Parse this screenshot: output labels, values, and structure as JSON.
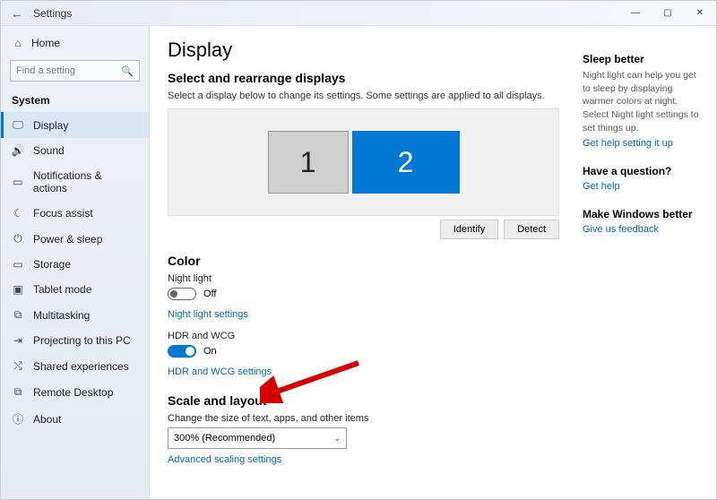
{
  "window": {
    "title": "Settings"
  },
  "sidebar": {
    "home": "Home",
    "search_placeholder": "Find a setting",
    "section": "System",
    "items": [
      {
        "label": "Display"
      },
      {
        "label": "Sound"
      },
      {
        "label": "Notifications & actions"
      },
      {
        "label": "Focus assist"
      },
      {
        "label": "Power & sleep"
      },
      {
        "label": "Storage"
      },
      {
        "label": "Tablet mode"
      },
      {
        "label": "Multitasking"
      },
      {
        "label": "Projecting to this PC"
      },
      {
        "label": "Shared experiences"
      },
      {
        "label": "Remote Desktop"
      },
      {
        "label": "About"
      }
    ]
  },
  "page": {
    "title": "Display",
    "rearrange_head": "Select and rearrange displays",
    "rearrange_desc": "Select a display below to change its settings. Some settings are applied to all displays.",
    "monitors": {
      "m1": "1",
      "m2": "2"
    },
    "identify": "Identify",
    "detect": "Detect",
    "color_head": "Color",
    "night_light_label": "Night light",
    "night_light_state": "Off",
    "night_light_link": "Night light settings",
    "hdr_label": "HDR and WCG",
    "hdr_state": "On",
    "hdr_link": "HDR and WCG settings",
    "scale_head": "Scale and layout",
    "scale_label": "Change the size of text, apps, and other items",
    "scale_value": "300% (Recommended)",
    "adv_scaling": "Advanced scaling settings"
  },
  "right": {
    "sleep_head": "Sleep better",
    "sleep_text": "Night light can help you get to sleep by displaying warmer colors at night. Select Night light settings to set things up.",
    "sleep_link": "Get help setting it up",
    "q_head": "Have a question?",
    "q_link": "Get help",
    "fb_head": "Make Windows better",
    "fb_link": "Give us feedback"
  }
}
